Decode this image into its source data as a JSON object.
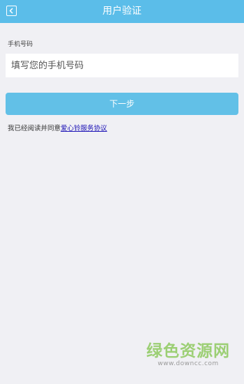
{
  "header": {
    "title": "用户验证",
    "back_icon": "chevron-left-icon"
  },
  "form": {
    "phone_label": "手机号码",
    "phone_placeholder": "填写您的手机号码",
    "phone_value": "",
    "next_label": "下一步"
  },
  "agreement": {
    "prefix": "我已经阅读并同意",
    "link_text": "爱心铃服务协议"
  },
  "watermark": {
    "title": "绿色资源网",
    "url": "www.downcc.com"
  },
  "colors": {
    "header_bg": "#5bbde9",
    "button_bg": "#62c0e7",
    "page_bg": "#f0f0f4",
    "link": "#1a10b5",
    "watermark": "#9ccf74"
  }
}
